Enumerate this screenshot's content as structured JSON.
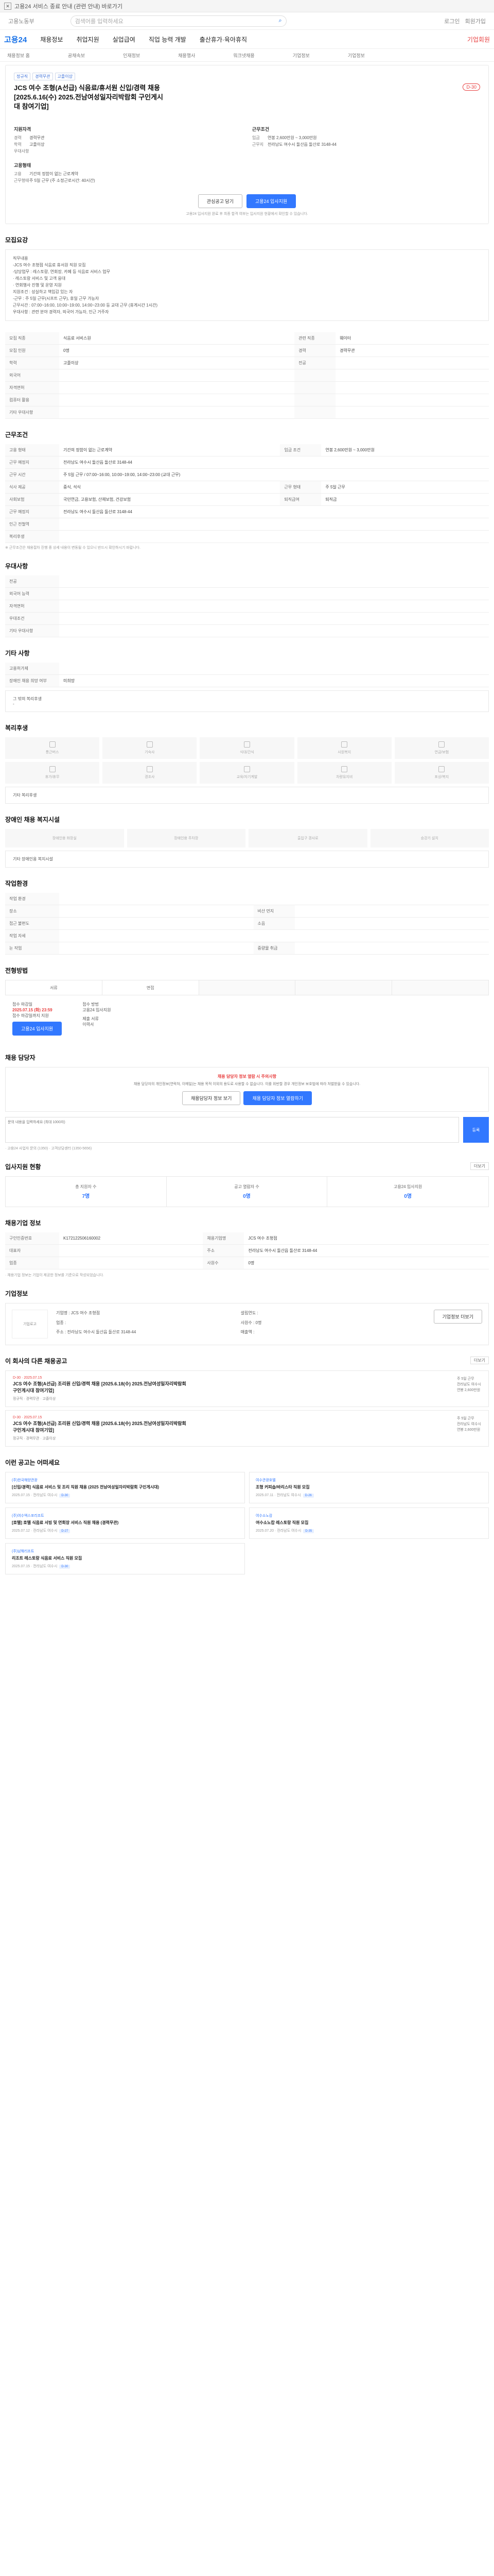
{
  "banner": {
    "text": "고용24 서비스 종료 안내 (관련 안내) 바로가기"
  },
  "topbar": {
    "lang": "고용노동부",
    "search_placeholder": "검색어를 입력하세요",
    "search_button": "검색",
    "login": "로그인",
    "join": "회원가입"
  },
  "gnb": {
    "logo": "고용24",
    "items": [
      "채용정보",
      "취업지원",
      "실업급여",
      "직업 능력 개발",
      "출산휴가·육아휴직"
    ],
    "highlight": "기업회원"
  },
  "subnav": [
    "채용정보 홈",
    "공채속보",
    "인재정보",
    "채용행사",
    "워크넷채용",
    "기업정보",
    "기업정보"
  ],
  "job": {
    "tags": [
      "정규직",
      "경력무관",
      "고졸이상"
    ],
    "title": "JCS 여수 조형(A선급) 식음료/휴서원 신입/경력 채용 [2025.6.16(수) 2025.전남여성일자리박람회 구인게시대 참여기업]",
    "dday": "D-30",
    "left_head": "지원자격",
    "left": [
      {
        "k": "경력",
        "v": "경력무관"
      },
      {
        "k": "학력",
        "v": "고졸이상"
      },
      {
        "k": "우대사항",
        "v": ""
      }
    ],
    "left_head2": "고용형태",
    "left2": [
      {
        "k": "고용",
        "v": "기간의 정함이 없는 근로계약"
      },
      {
        "k": "근무형태",
        "v": "주 5일 근무 (주 소정근로시간: 40시간)"
      }
    ],
    "right_head": "근무조건",
    "right": [
      {
        "k": "임금",
        "v": "연봉 2,600만원 ~ 3,000만원"
      },
      {
        "k": "근무지",
        "v": "전라남도 여수시 돌산읍 돌산로 3148-44"
      },
      {
        "k": "",
        "v": ""
      },
      {
        "k": "",
        "v": ""
      }
    ],
    "btn_scrap": "관심공고 담기",
    "btn_apply": "고용24 입사지원",
    "note": "고용24 입사지원 완료 후 최종 합격 여부는 입사지원 현황에서 확인할 수 있습니다."
  },
  "recruit": {
    "title": "모집요강",
    "text": "직무내용\n-JCS 여수 조형점 식음료 휴서원 직원 모집\n-담당업무 : 레스토랑, 연회장, 카페 등 식음료 서비스 업무\n  · 레스토랑 서비스 및 고객 응대\n  · 연회행사 진행 및 운영 지원\n지원조건 : 성실하고 책임감 있는 자\n-근무 : 주 5일 근무(시프트 근무), 휴일 근무 가능자\n근무시간 : 07:00~16:00, 10:00~19:00, 14:00~23:00 등 교대 근무 (휴게시간 1시간)\n우대사항 : 관련 분야 경력자, 외국어 가능자, 인근 거주자"
  },
  "detail": {
    "title": "지원자격",
    "rows": [
      {
        "k": "모집 직종",
        "v": "식음료 서비스원",
        "k2": "관련 직종",
        "v2": "웨이터"
      },
      {
        "k": "모집 인원",
        "v": "0명",
        "k2": "경력",
        "v2": "경력무관"
      },
      {
        "k": "학력",
        "v": "고졸이상",
        "k2": "전공",
        "v2": ""
      },
      {
        "k": "외국어",
        "v": "",
        "k2": "",
        "v2": ""
      },
      {
        "k": "자격면허",
        "v": "",
        "k2": "",
        "v2": ""
      },
      {
        "k": "컴퓨터 활용",
        "v": "",
        "k2": "",
        "v2": ""
      },
      {
        "k": "기타 우대사항",
        "v": "",
        "k2": "",
        "v2": ""
      }
    ]
  },
  "conditions": {
    "title": "근무조건",
    "rows": [
      {
        "k": "고용 형태",
        "v": "기간의 정함이 없는 근로계약",
        "k2": "임금 조건",
        "v2": "연봉 2,600만원 ~ 3,000만원"
      },
      {
        "k": "근무 예정지",
        "v": "전라남도 여수시 돌산읍 돌산로 3148-44",
        "k2": "",
        "v2": ""
      },
      {
        "k": "근무 시간",
        "v": "주 5일 근무 / 07:00~16:00, 10:00~19:00, 14:00~23:00 (교대 근무)",
        "k2": "",
        "v2": ""
      },
      {
        "k": "식사 제공",
        "v": "중식, 석식",
        "k2": "근무 형태",
        "v2": "주 5일 근무"
      },
      {
        "k": "사회보험",
        "v": "국민연금, 고용보험, 산재보험, 건강보험",
        "k2": "퇴직급여",
        "v2": "퇴직금"
      },
      {
        "k": "근무 예정지",
        "v": "전라남도 여수시 돌산읍 돌산로 3148-44",
        "k2": "",
        "v2": ""
      },
      {
        "k": "인근 전철역",
        "v": "",
        "k2": "",
        "v2": ""
      },
      {
        "k": "복리후생",
        "v": "",
        "k2": "",
        "v2": ""
      }
    ],
    "note": "※ 근무조건은 채용절차 진행 중 상세 내용이 변동될 수 있으니 반드시 확인하시기 바랍니다."
  },
  "benefits": {
    "title": "우대사항",
    "rows": [
      {
        "k": "전공",
        "v": ""
      },
      {
        "k": "외국어 능력",
        "v": ""
      },
      {
        "k": "자격면허",
        "v": ""
      },
      {
        "k": "우대조건",
        "v": ""
      },
      {
        "k": "기타 우대사항",
        "v": ""
      }
    ]
  },
  "support": {
    "title": "기타 사항",
    "rows": [
      {
        "k": "고용허가제",
        "v": ""
      },
      {
        "k": "장애인 채용 희망 여부",
        "v": "미희망"
      }
    ],
    "extra_label": "그 밖의 복리후생",
    "extra_value": "-"
  },
  "welfare": {
    "title": "복리후생",
    "items": [
      "통근버스",
      "기숙사",
      "식대/간식",
      "사원복지",
      "연금/보험",
      "휴가/휴무",
      "경조사",
      "교육/자기계발",
      "차량유지비",
      "포상/복지"
    ],
    "other_label": "기타 복리후생"
  },
  "disability": {
    "title": "장애인 채용 복지시설",
    "items": [
      "장애인용 화장실",
      "장애인용 주차장",
      "출입구 경사로",
      "승강기 설치"
    ],
    "other_label": "기타 장애인용 복지시설"
  },
  "env": {
    "title": "작업환경",
    "rows": [
      {
        "k": "작업 환경",
        "v": "",
        "k2": "",
        "v2": ""
      },
      {
        "k": "장소",
        "v": "",
        "k2": "비산 먼지",
        "v2": ""
      },
      {
        "k": "접근 불편도",
        "v": "",
        "k2": "소음",
        "v2": ""
      },
      {
        "k": "작업 자세",
        "v": "",
        "k2": "",
        "v2": ""
      },
      {
        "k": "눈 작업",
        "v": "",
        "k2": "중량물 취급",
        "v2": ""
      }
    ]
  },
  "process": {
    "title": "전형방법",
    "steps": [
      "서류",
      "면접",
      "",
      "",
      "",
      "",
      ""
    ],
    "left_label": "접수 마감일",
    "deadline": "2025.07.15 (화) 23:59",
    "deadline_note": "접수 마감일까지 지원",
    "right_label": "접수 방법",
    "method": "고용24 입사지원",
    "right_label2": "제출 서류",
    "docs": "이력서",
    "btn": "고용24 입사지원"
  },
  "manager": {
    "title": "채용 담당자",
    "alert": "채용 담당자 정보 열람 시 주의사항",
    "text": "채용 담당자의 개인정보(연락처, 이메일)는 채용 목적 이외의 용도로 사용할 수 없습니다. 이를 위반할 경우 개인정보 보호법에 따라 처벌받을 수 있습니다.",
    "btn1": "채용담당자 정보 보기",
    "btn2": "채용 담당자 정보 열람하기",
    "qa_label": "채용 담당자에게 문의하기",
    "qa_placeholder": "문의 내용을 입력하세요 (최대 1000자)",
    "qa_btn": "등록",
    "qa_note": "· 고용24 사업자 문의 (1350) · 고객상담센터 (1350-5656)",
    "qa_count": "0 / 1000"
  },
  "stats": {
    "title": "입사지원 현황",
    "more": "더보기",
    "items": [
      {
        "label": "총 지원자 수",
        "value": "7명"
      },
      {
        "label": "공고 열람자 수",
        "value": "0명"
      },
      {
        "label": "고용24 입사지원",
        "value": "0명"
      }
    ]
  },
  "info": {
    "title": "채용기업 정보",
    "rows": [
      {
        "k": "구인인증번호",
        "v": "K172122506160002",
        "k2": "채용기업명",
        "v2": "JCS 여수 조형점"
      },
      {
        "k": "대표자",
        "v": "",
        "k2": "주소",
        "v2": "전라남도 여수시 돌산읍 돌산로 3148-44"
      },
      {
        "k": "업종",
        "v": "",
        "k2": "사원수",
        "v2": "0명"
      }
    ],
    "note": "· 채용기업 정보는 기업이 제공한 정보를 기준으로 작성되었습니다."
  },
  "company": {
    "title": "기업정보",
    "logo": "기업로고",
    "btn": "기업정보 더보기",
    "rows": [
      {
        "k": "기업명",
        "v": "JCS 여수 조형점",
        "k2": "설립연도",
        "v2": ""
      },
      {
        "k": "업종",
        "v": "",
        "k2": "사원수",
        "v2": "0명"
      },
      {
        "k": "주소",
        "v": "전라남도 여수시 돌산읍 돌산로 3148-44",
        "k2": "매출액",
        "v2": ""
      }
    ]
  },
  "related": {
    "title": "이 회사의 다른 채용공고",
    "more": "더보기",
    "items": [
      {
        "d": "D-30 · 2025.07.15",
        "t": "JCS 여수 조형(A선급) 조리원 신입/경력 채용 [2025.6.18(수) 2025.전남여성일자리박람회 구인게시대 참여기업]",
        "m": "정규직 · 경력무관 · 고졸이상",
        "r1": "주 5일 근무",
        "r2": "전라남도 여수시",
        "r3": "연봉 2,600만원"
      },
      {
        "d": "D-30 · 2025.07.15",
        "t": "JCS 여수 조형(A선급) 조리원 신입/경력 채용 [2025.6.18(수) 2025.전남여성일자리박람회 구인게시대 참여기업]",
        "m": "정규직 · 경력무관 · 고졸이상",
        "r1": "주 5일 근무",
        "r2": "전라남도 여수시",
        "r3": "연봉 2,600만원"
      }
    ]
  },
  "recommend": {
    "title": "이런 공고는 어떠세요",
    "cards": [
      {
        "c": "(주)한국해양관광",
        "t": "[신입/경력] 식음료 서비스 및 조리 직원 채용 (2025 전남여성일자리박람회 구인게시대)",
        "dt": "2025.07.15 · 전라남도 여수시",
        "pill": "D-30"
      },
      {
        "c": "여수관광호텔",
        "t": "조형 커피숍/바리스타 직원 모집",
        "dt": "2025.07.11 · 전라남도 여수시",
        "pill": "D-26"
      },
      {
        "c": "(주)여수엑스포리조트",
        "t": "[호텔] 호텔 식음료 서빙 및 연회장 서비스 직원 채용 (경력무관)",
        "dt": "2025.07.12 · 전라남도 여수시",
        "pill": "D-27"
      },
      {
        "c": "여수소노캄",
        "t": "여수소노캄 레스토랑 직원 모집",
        "dt": "2025.07.20 · 전라남도 여수시",
        "pill": "D-35"
      },
      {
        "c": "(주)남해리조트",
        "t": "리조트 레스토랑 식음료 서비스 직원 모집",
        "dt": "2025.07.15 · 전라남도 여수시",
        "pill": "D-30"
      },
      {
        "c": "",
        "t": "",
        "dt": "",
        "pill": ""
      }
    ]
  }
}
